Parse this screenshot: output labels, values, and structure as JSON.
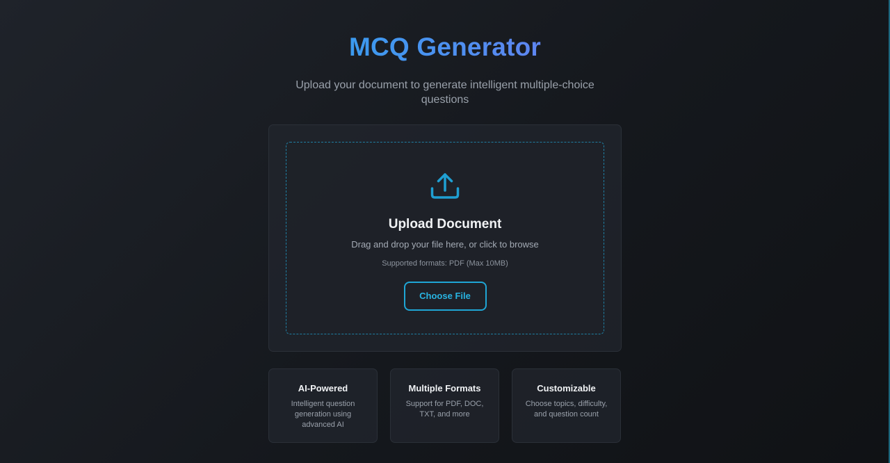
{
  "header": {
    "title": "MCQ Generator",
    "subtitle": "Upload your document to generate intelligent multiple-choice questions"
  },
  "upload": {
    "icon": "upload-icon",
    "title": "Upload Document",
    "description": "Drag and drop your file here, or click to browse",
    "formats": "Supported formats: PDF (Max 10MB)",
    "button_label": "Choose File"
  },
  "features": [
    {
      "title": "AI-Powered",
      "description": "Intelligent question generation using advanced AI"
    },
    {
      "title": "Multiple Formats",
      "description": "Support for PDF, DOC, TXT, and more"
    },
    {
      "title": "Customizable",
      "description": "Choose topics, difficulty, and question count"
    }
  ],
  "colors": {
    "accent": "#1fa6d6",
    "title_gradient_start": "#2ea2ee",
    "title_gradient_end": "#6f7bf2",
    "background": "#1a1d22"
  }
}
